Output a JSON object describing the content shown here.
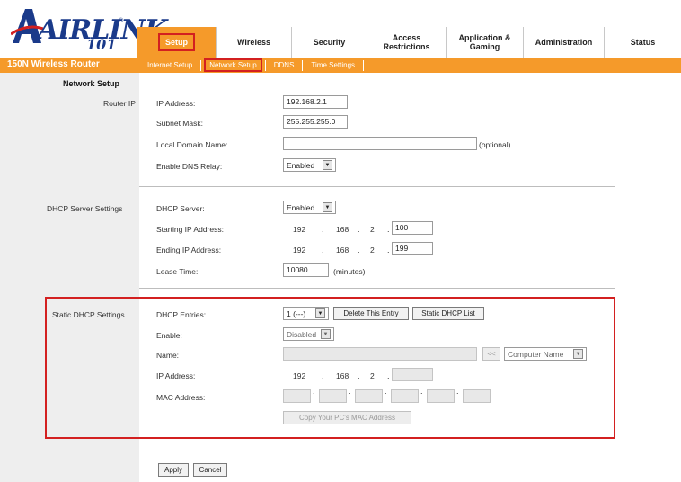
{
  "brand": {
    "logo_text": "AIRLINK",
    "logo_number": "101",
    "registered": "®"
  },
  "tabs": [
    {
      "label": "Setup"
    },
    {
      "label": "Wireless"
    },
    {
      "label": "Security"
    },
    {
      "label": "Access Restrictions"
    },
    {
      "label": "Application & Gaming"
    },
    {
      "label": "Administration"
    },
    {
      "label": "Status"
    }
  ],
  "product_name": "150N Wireless Router",
  "subnav": [
    "Internet Setup",
    "Network Setup",
    "DDNS",
    "Time Settings"
  ],
  "page_title": "Network Setup",
  "router_ip": {
    "section_label": "Router IP",
    "ip_label": "IP Address:",
    "ip_value": "192.168.2.1",
    "mask_label": "Subnet Mask:",
    "mask_value": "255.255.255.0",
    "domain_label": "Local Domain Name:",
    "domain_value": "",
    "domain_hint": "(optional)",
    "dns_relay_label": "Enable DNS Relay:",
    "dns_relay_value": "Enabled"
  },
  "dhcp": {
    "section_label": "DHCP Server Settings",
    "server_label": "DHCP Server:",
    "server_value": "Enabled",
    "start_label": "Starting IP Address:",
    "start_octets": [
      "192",
      "168",
      "2"
    ],
    "start_last": "100",
    "end_label": "Ending IP Address:",
    "end_octets": [
      "192",
      "168",
      "2"
    ],
    "end_last": "199",
    "lease_label": "Lease Time:",
    "lease_value": "10080",
    "lease_unit": "(minutes)"
  },
  "static_dhcp": {
    "section_label": "Static DHCP Settings",
    "entries_label": "DHCP Entries:",
    "entries_value": "1 (---)",
    "delete_button": "Delete This Entry",
    "list_button": "Static DHCP List",
    "enable_label": "Enable:",
    "enable_value": "Disabled",
    "name_label": "Name:",
    "name_value": "",
    "copy_name_button": "<<",
    "computer_name_value": "Computer Name",
    "ip_label": "IP Address:",
    "ip_octets": [
      "192",
      "168",
      "2"
    ],
    "mac_label": "MAC Address:",
    "copy_mac_button": "Copy Your PC's MAC Address"
  },
  "actions": {
    "apply": "Apply",
    "cancel": "Cancel"
  },
  "colors": {
    "accent": "#f59a2a",
    "highlight": "#d32020",
    "brand": "#1a3a8a"
  }
}
